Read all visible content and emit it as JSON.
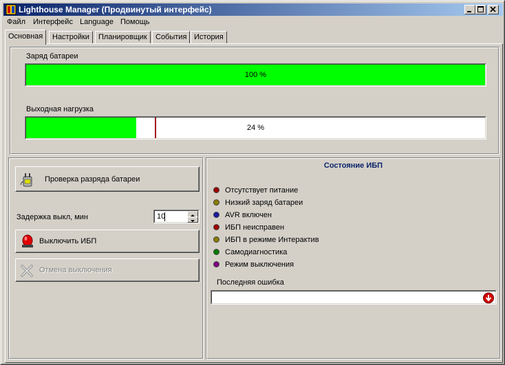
{
  "window": {
    "title": "Lighthouse Manager (Продвинутый интерфейс)"
  },
  "menu": {
    "items": [
      {
        "label": "Файл",
        "hotkey_index": 0
      },
      {
        "label": "Интерфейс",
        "hotkey_index": 0
      },
      {
        "label": "Language",
        "hotkey_index": 0
      },
      {
        "label": "Помощь",
        "hotkey_index": 0
      }
    ]
  },
  "tabs": [
    {
      "label": "Основная",
      "active": true
    },
    {
      "label": "Настройки",
      "active": false
    },
    {
      "label": "Планировщик",
      "active": false
    },
    {
      "label": "События",
      "active": false
    },
    {
      "label": "История",
      "active": false
    }
  ],
  "battery": {
    "label": "Заряд батареи",
    "value_text": "100 %",
    "fraction": 1.0
  },
  "load": {
    "label": "Выходная нагрузка",
    "value_text": "24 %",
    "fraction": 0.24,
    "marker_fraction": 0.28
  },
  "controls": {
    "battery_test_label": "Проверка разряда батареи",
    "delay_label": "Задержка выкл, мин",
    "delay_value": "10",
    "shutdown_label": "Выключить ИБП",
    "cancel_label": "Отмена выключения"
  },
  "status": {
    "title": "Состояние ИБП",
    "indicators": [
      {
        "label": "Отсутствует питание",
        "color": "#a00000"
      },
      {
        "label": "Низкий заряд батареи",
        "color": "#8a7d00"
      },
      {
        "label": "AVR включен",
        "color": "#1a1aa0"
      },
      {
        "label": "ИБП неисправен",
        "color": "#a00000"
      },
      {
        "label": "ИБП в режиме Интерактив",
        "color": "#8a7d00"
      },
      {
        "label": "Самодиагностика",
        "color": "#007a00"
      },
      {
        "label": "Режим выключения",
        "color": "#800080"
      }
    ],
    "last_error_label": "Последняя ошибка",
    "last_error_value": ""
  },
  "colors": {
    "progress_fill": "#00ff00",
    "title_gradient_start": "#0a246a",
    "title_gradient_end": "#a6caf0",
    "status_title": "#0a246a",
    "face": "#d4d0c8"
  },
  "icons": {
    "app": "lighthouse-app-icon",
    "battery_test": "battery-plug-icon",
    "shutdown": "red-alarm-lamp-icon",
    "cancel": "gray-x-icon",
    "error_dropdown": "red-down-arrow-icon"
  }
}
